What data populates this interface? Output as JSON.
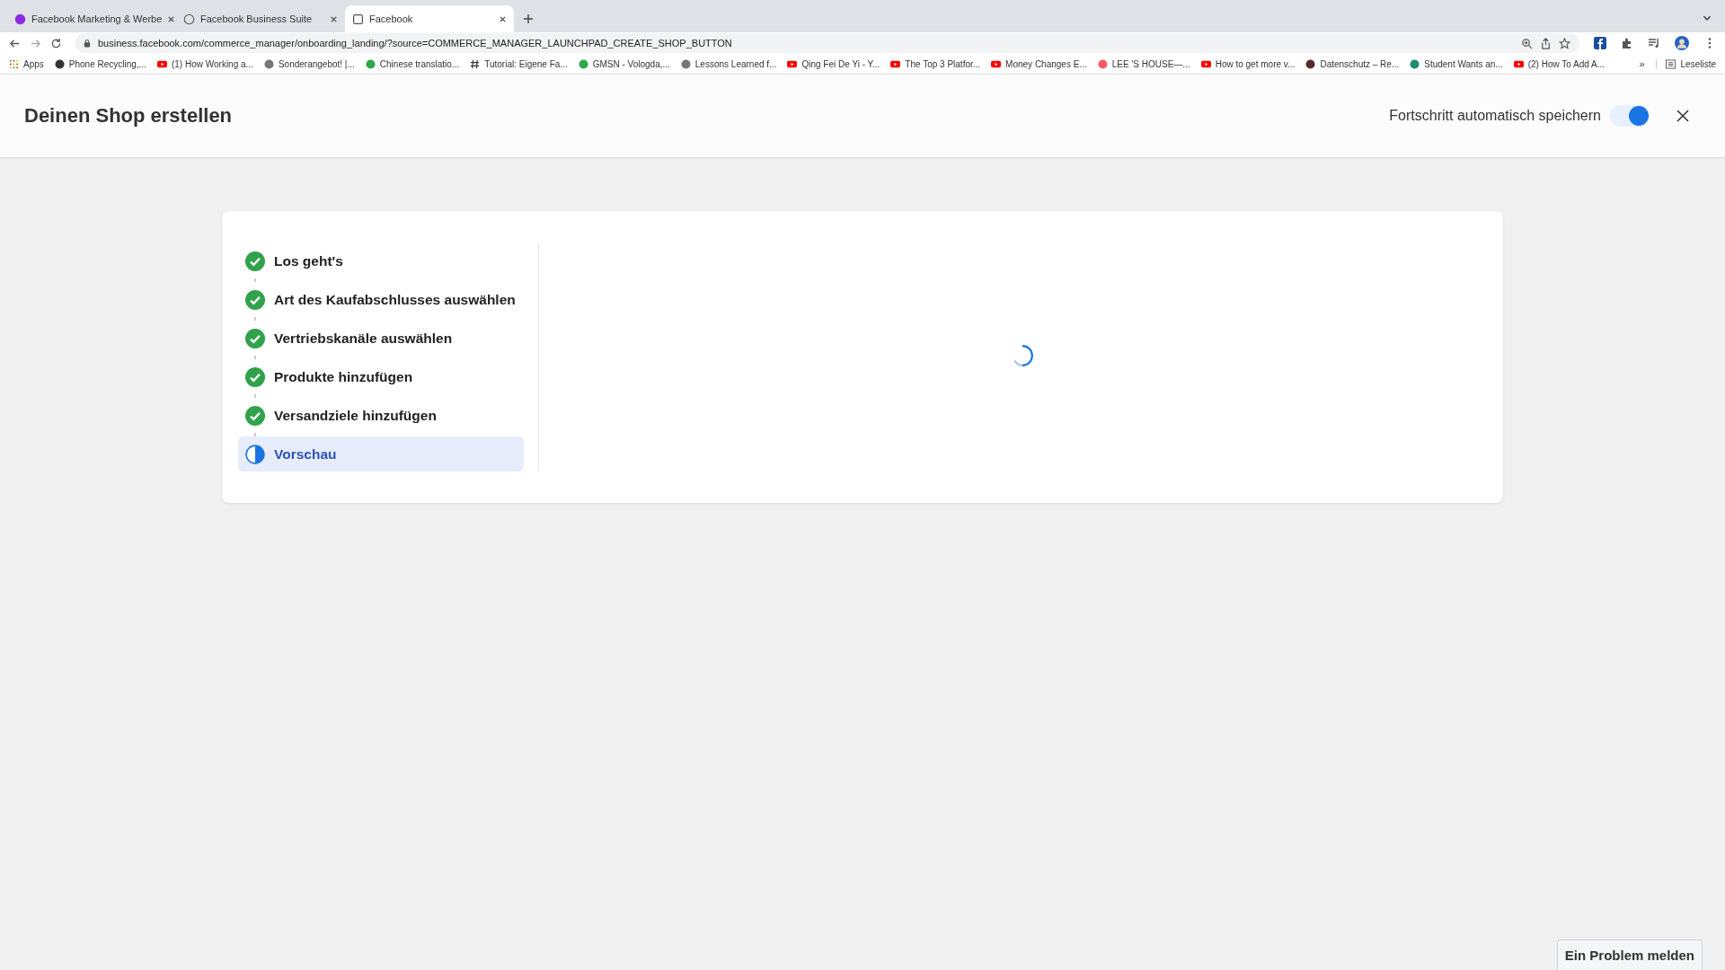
{
  "browser": {
    "tabs": [
      {
        "title": "Facebook Marketing & Werbe",
        "selected": false
      },
      {
        "title": "Facebook Business Suite",
        "selected": false
      },
      {
        "title": "Facebook",
        "selected": true
      }
    ],
    "url": "business.facebook.com/commerce_manager/onboarding_landing/?source=COMMERCE_MANAGER_LAUNCHPAD_CREATE_SHOP_BUTTON",
    "bookmarks": [
      "Apps",
      "Phone Recycling,...",
      "(1) How Working a...",
      "Sonderangebot! |...",
      "Chinese translatio...",
      "Tutorial: Eigene Fa...",
      "GMSN - Vologda,...",
      "Lessons Learned f...",
      "Qing Fei De Yi - Y...",
      "The Top 3 Platfor...",
      "Money Changes E...",
      "LEE 'S HOUSE—...",
      "How to get more v...",
      "Datenschutz – Re...",
      "Student Wants an...",
      "(2) How To Add A..."
    ],
    "more": "»",
    "reading_list": "Leseliste"
  },
  "header": {
    "title": "Deinen Shop erstellen",
    "autosave_label": "Fortschritt automatisch speichern",
    "autosave_on": true
  },
  "steps": [
    {
      "label": "Los geht's",
      "kind": "done",
      "selected": false
    },
    {
      "label": "Art des Kaufabschlusses auswählen",
      "kind": "done",
      "selected": false
    },
    {
      "label": "Vertriebskanäle auswählen",
      "kind": "done",
      "selected": false
    },
    {
      "label": "Produkte hinzufügen",
      "kind": "done",
      "selected": false
    },
    {
      "label": "Versandziele hinzufügen",
      "kind": "done",
      "selected": false
    },
    {
      "label": "Vorschau",
      "kind": "current",
      "selected": true
    }
  ],
  "report_button": "Ein Problem melden"
}
